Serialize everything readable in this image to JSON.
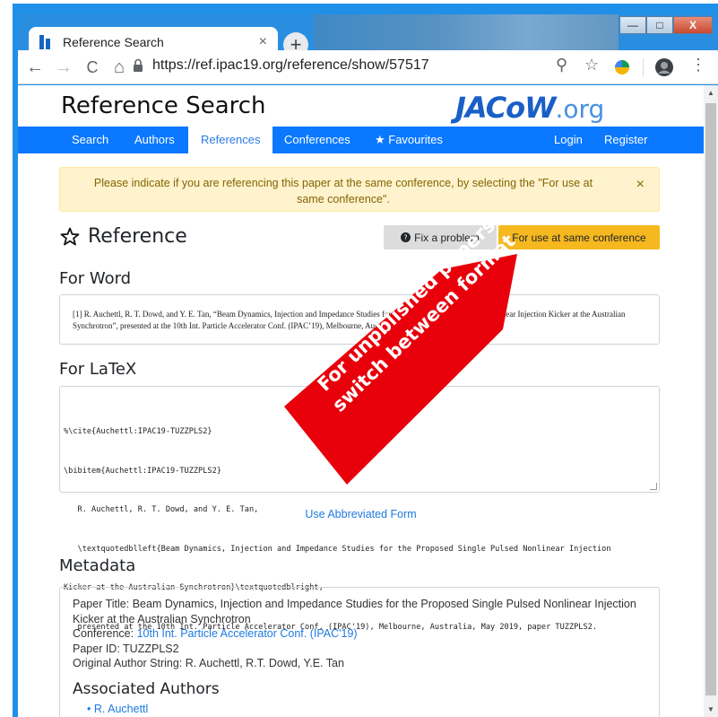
{
  "browser": {
    "tab_title": "Reference Search",
    "tab_close": "×",
    "new_tab": "+",
    "url": "https://ref.ipac19.org/reference/show/57517",
    "back": "←",
    "forward": "→",
    "reload": "C",
    "home": "⌂",
    "zoom": "⚲",
    "star": "☆",
    "menu": "⋮",
    "win_min": "—",
    "win_max": "□",
    "win_close": "X"
  },
  "site": {
    "title": "Reference Search",
    "logo_main": "JACoW",
    "logo_suffix": ".org"
  },
  "nav": {
    "items": [
      "Search",
      "Authors",
      "References",
      "Conferences",
      "★ Favourites"
    ],
    "right": [
      "Login",
      "Register"
    ],
    "active": "References"
  },
  "alert": {
    "text": "Please indicate if you are referencing this paper at the same conference, by selecting the \"For use at same conference\".",
    "close": "×"
  },
  "reference": {
    "heading": "Reference",
    "fix_label": "Fix a problem",
    "same_conf_label": "For use at same conference"
  },
  "word": {
    "title": "For Word",
    "line1": "[1]  R. Auchettl, R. T. Dowd, and Y. E. Tan, “Beam Dynamics, Injection and Impedance Studies for the Proposed Single Pulsed Nonlinear Injection Kicker at the Australian",
    "line2": "Synchrotron”, presented at the 10th Int. Particle Accelerator Conf. (IPAC’19), Melbourne, Australia, May 2019, paper TUZZPLS2."
  },
  "latex": {
    "title": "For LaTeX",
    "lines": [
      "%\\cite{Auchettl:IPAC19-TUZZPLS2}",
      "\\bibitem{Auchettl:IPAC19-TUZZPLS2}",
      "   R. Auchettl, R. T. Dowd, and Y. E. Tan,",
      "   \\textquotedblleft{Beam Dynamics, Injection and Impedance Studies for the Proposed Single Pulsed Nonlinear Injection",
      "Kicker at the Australian Synchrotron}\\textquotedblright,",
      "   presented at the 10th Int. Particle Accelerator Conf. (IPAC'19), Melbourne, Australia, May 2019, paper TUZZPLS2."
    ]
  },
  "abbreviated_link": "Use Abbreviated Form",
  "metadata": {
    "title": "Metadata",
    "paper_title_label": "Paper Title: ",
    "paper_title_value": "Beam Dynamics, Injection and Impedance Studies for the Proposed Single Pulsed Nonlinear Injection Kicker at the Australian Synchrotron",
    "conference_label": "Conference: ",
    "conference_value": "10th Int. Particle Accelerator Conf. (IPAC'19)",
    "paper_id": "Paper ID: TUZZPLS2",
    "author_string": "Original Author String: R. Auchettl, R.T. Dowd, Y.E. Tan",
    "associated_title": "Associated Authors",
    "authors": [
      "R. Auchettl"
    ]
  },
  "annotation": {
    "text": "For unpblished papers switch between format",
    "color": "#e8000b"
  },
  "colors": {
    "nav_blue": "#0a78ff",
    "alert_bg": "#fff3cd",
    "same_conf_button": "#f5b81f",
    "link": "#1f7ae0"
  }
}
